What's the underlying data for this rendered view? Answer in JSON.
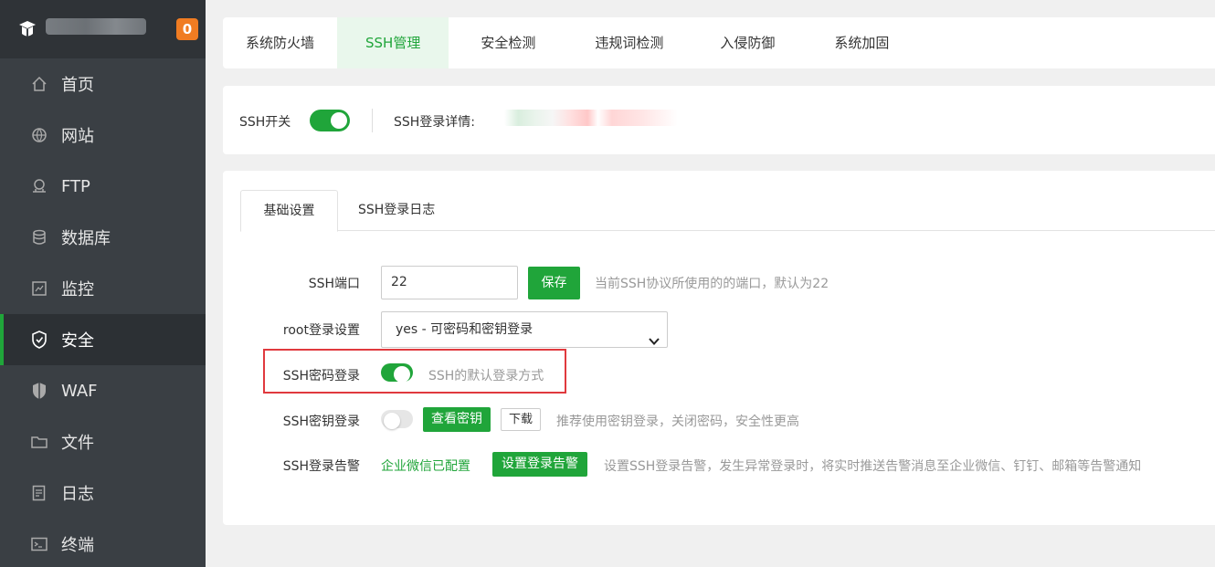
{
  "sidebar": {
    "badge": "0",
    "items": [
      {
        "label": "首页",
        "icon": "home-icon"
      },
      {
        "label": "网站",
        "icon": "globe-icon"
      },
      {
        "label": "FTP",
        "icon": "ftp-icon"
      },
      {
        "label": "数据库",
        "icon": "database-icon"
      },
      {
        "label": "监控",
        "icon": "monitor-icon"
      },
      {
        "label": "安全",
        "icon": "shield-icon",
        "active": true
      },
      {
        "label": "WAF",
        "icon": "waf-shield-icon"
      },
      {
        "label": "文件",
        "icon": "folder-icon"
      },
      {
        "label": "日志",
        "icon": "log-icon"
      },
      {
        "label": "终端",
        "icon": "terminal-icon"
      }
    ]
  },
  "top_tabs": [
    "系统防火墙",
    "SSH管理",
    "安全检测",
    "违规词检测",
    "入侵防御",
    "系统加固"
  ],
  "ssh_bar": {
    "switch_label": "SSH开关",
    "switch_on": true,
    "detail_label": "SSH登录详情:"
  },
  "sub_tabs": [
    "基础设置",
    "SSH登录日志"
  ],
  "form": {
    "port_label": "SSH端口",
    "port_value": "22",
    "save_label": "保存",
    "port_hint": "当前SSH协议所使用的的端口，默认为22",
    "root_label": "root登录设置",
    "root_value": "yes - 可密码和密钥登录",
    "password_login_label": "SSH密码登录",
    "password_login_on": true,
    "password_login_hint": "SSH的默认登录方式",
    "key_login_label": "SSH密钥登录",
    "key_login_on": false,
    "view_key_label": "查看密钥",
    "download_label": "下载",
    "key_login_hint": "推荐使用密钥登录，关闭密码，安全性更高",
    "alert_label": "SSH登录告警",
    "alert_status": "企业微信已配置",
    "alert_button_label": "设置登录告警",
    "alert_hint": "设置SSH登录告警，发生异常登录时，将实时推送告警消息至企业微信、钉钉、邮箱等告警通知"
  },
  "colors": {
    "accent": "#20a53a",
    "sidebar_bg": "#3a3f44",
    "badge": "#f07c22",
    "highlight": "#e0393e"
  }
}
